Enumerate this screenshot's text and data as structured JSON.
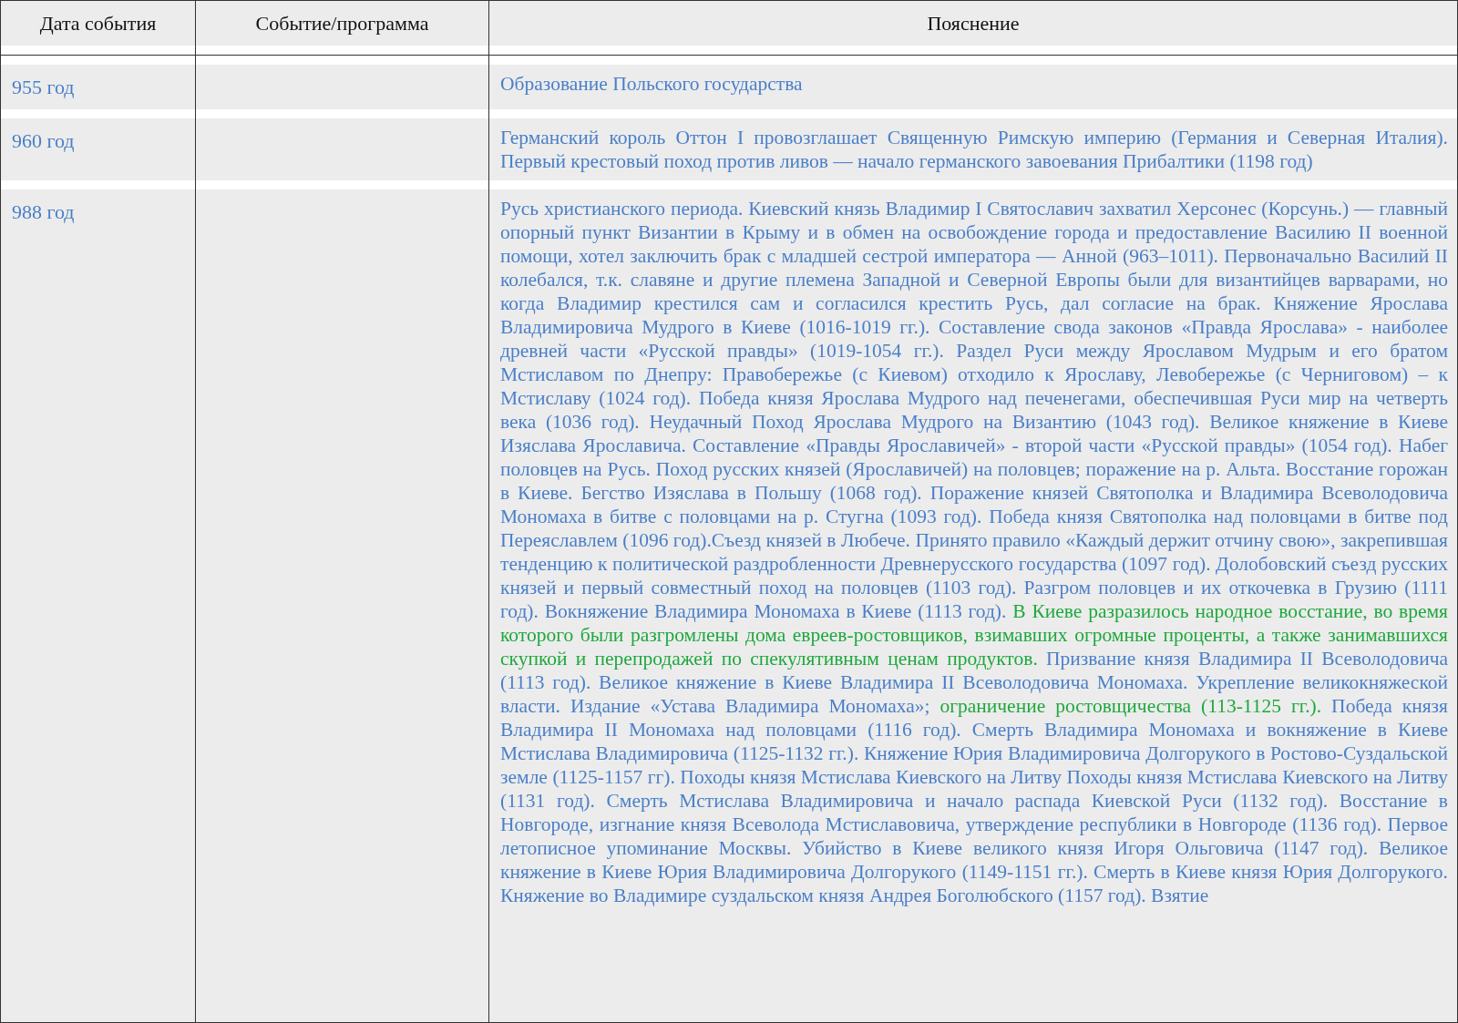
{
  "table": {
    "columns": [
      "Дата события",
      "Событие/программа",
      "Пояснение"
    ],
    "rows": [
      {
        "date": "955 год",
        "explanation": [
          {
            "text": "Образование Польского государства",
            "color": "#4a7fc8"
          }
        ]
      },
      {
        "date": "960 год",
        "explanation": [
          {
            "text": "Германский король Оттон I провозглашает Священную Римскую империю (Германия и Северная Италия). Первый крестовый поход против ливов — начало германского завоевания Прибалтики (1198 год)",
            "color": "#4a7fc8"
          }
        ]
      },
      {
        "date": "988 год",
        "explanation": [
          {
            "text": "Русь христианского периода. Киевский князь Владимир I Святославич захватил Херсонес (Корсунь.) — главный опорный пункт Византии в Крыму и в обмен на освобождение города и предоставление Василию II военной помощи, хотел заключить брак с младшей сестрой императора — Анной (963–1011). Первоначально Василий II колебался, т.к. славяне и другие племена Западной и Северной Европы были для византийцев варварами, но когда Владимир крестился сам и согласился крестить Русь, дал согласие на брак. Княжение Ярослава Владимировича Мудрого в Киеве (1016-1019 гг.). Составление свода законов «Правда Ярослава» - наиболее древней части «Русской правды» (1019-1054 гг.). Раздел Руси между Ярославом Мудрым и его братом Мстиславом по Днепру: Правобережье (с Киевом) отходило к Ярославу, Левобережье (с Черниговом) – к Мстиславу (1024 год). Победа князя Ярослава Мудрого над печенегами, обеспечившая Руси мир на четверть века (1036 год). Неудачный Поход Ярослава Мудрого на Византию (1043 год). Великое княжение в Киеве Изяслава Ярославича. Составление «Правды Ярославичей» - второй части «Русской правды» (1054 год). Набег половцев на Русь. Поход русских князей (Ярославичей) на половцев; поражение на р. Альта. Восстание горожан в Киеве. Бегство Изяслава в Польшу (1068 год). Поражение князей Святополка и Владимира Всеволодовича Мономаха в битве с половцами на р. Стугна (1093 год). Победа князя Святополка над половцами в битве под Переяславлем (1096 год).Съезд князей в Любече. Принято правило «Каждый держит отчину свою», закрепившая тенденцию к политической раздробленности Древнерусского государства (1097 год). Долобовский съезд русских князей и первый совместный поход на половцев (1103 год). Разгром половцев и их откочевка в Грузию (1111 год). Вокняжение Владимира Мономаха в Киеве (1113 год). ",
            "color": "#4a7fc8"
          },
          {
            "text": "В Киеве разразилось народное восстание, во время которого были разгромлены дома евреев-ростовщиков, взимавших огромные проценты, а также занимавшихся скупкой и перепродажей по спекулятивным ценам продуктов.",
            "color": "#1ea83c"
          },
          {
            "text": " Призвание князя Владимира II Всеволодовича (1113 год). Великое княжение в Киеве Владимира II Всеволодовича Мономаха. Укрепление великокняжеской власти. Издание «Устава Владимира Мономаха»; ",
            "color": "#4a7fc8"
          },
          {
            "text": "ограничение ростовщичества (113-1125 гг.).",
            "color": "#1ea83c"
          },
          {
            "text": " Победа князя Владимира II Мономаха над половцами (1116 год). Смерть Владимира Мономаха и вокняжение в Киеве Мстислава Владимировича (1125-1132 гг.). Княжение Юрия Владимировича Долгорукого в Ростово-Суздальской земле (1125-1157 гг). Походы князя Мстислава Киевского на Литву Походы князя Мстислава Киевского на Литву (1131 год). Смерть Мстислава Владимировича и начало распада Киевской Руси (1132 год). Восстание в Новгороде, изгнание князя Всеволода Мстиславовича, утверждение республики в Новгороде (1136 год). Первое летописное упоминание Москвы. Убийство в Киеве великого князя Игоря Ольговича (1147 год). Великое княжение в Киеве Юрия Владимировича Долгорукого (1149-1151 гг.). Смерть в Киеве князя Юрия Долгорукого. Княжение во Владимире суздальском князя Андрея Боголюбского (1157 год). Взятие",
            "color": "#4a7fc8"
          }
        ]
      }
    ]
  }
}
